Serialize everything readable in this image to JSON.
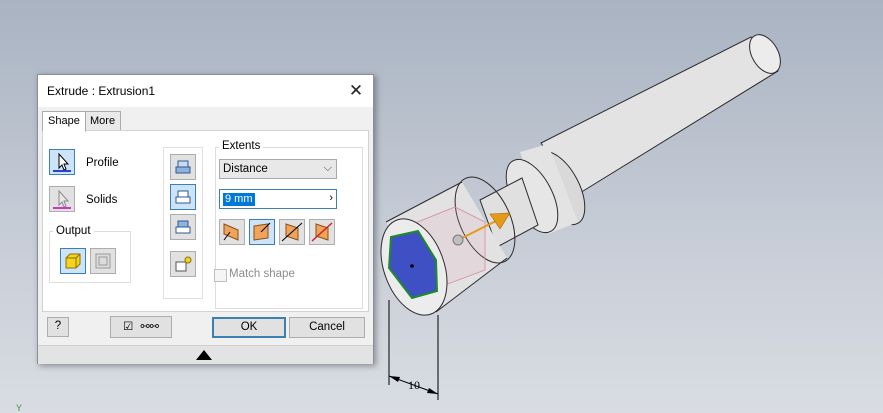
{
  "dialog": {
    "title": "Extrude : Extrusion1",
    "tabs": [
      {
        "label": "Shape"
      },
      {
        "label": "More"
      }
    ],
    "active_tab": "Shape",
    "selectors": {
      "profile_label": "Profile",
      "solids_label": "Solids"
    },
    "output": {
      "group_label": "Output"
    },
    "extents": {
      "group_label": "Extents",
      "type_value": "Distance",
      "distance_value": "9 mm"
    },
    "match_shape_label": "Match shape",
    "match_shape_checked": false,
    "preview_checked": true,
    "ok_label": "OK",
    "cancel_label": "Cancel",
    "help_label": "?"
  },
  "viewport": {
    "dimension_label": "10"
  },
  "colors": {
    "profile_face": "#3f4fc4",
    "profile_edge": "#1f8a28",
    "direction_arrow": "#e39a18",
    "accent": "#3c7fb1"
  }
}
